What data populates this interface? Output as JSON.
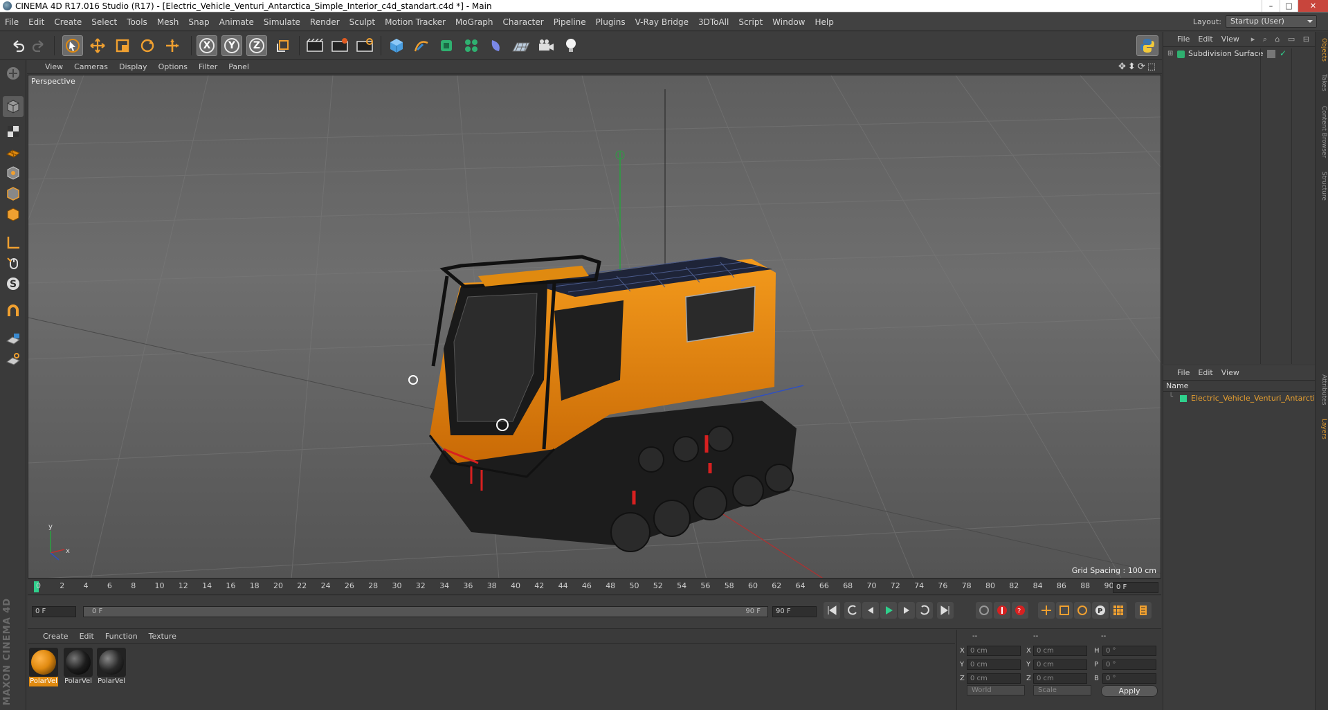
{
  "window": {
    "title": "CINEMA 4D R17.016 Studio (R17) - [Electric_Vehicle_Venturi_Antarctica_Simple_Interior_c4d_standart.c4d *] - Main",
    "controls": [
      "–",
      "□",
      "✕"
    ]
  },
  "menubar": {
    "items": [
      "File",
      "Edit",
      "Create",
      "Select",
      "Tools",
      "Mesh",
      "Snap",
      "Animate",
      "Simulate",
      "Render",
      "Sculpt",
      "Motion Tracker",
      "MoGraph",
      "Character",
      "Pipeline",
      "Plugins",
      "V-Ray Bridge",
      "3DToAll",
      "Script",
      "Window",
      "Help"
    ],
    "layout_label": "Layout:",
    "layout_value": "Startup (User)"
  },
  "toolbar": {
    "icons": [
      "undo-icon",
      "redo-icon",
      "live-selection-icon",
      "move-icon",
      "scale-icon",
      "rotate-icon",
      "last-tool-icon",
      "x-axis-icon",
      "y-axis-icon",
      "z-axis-icon",
      "coordinate-system-icon",
      "render-view-icon",
      "render-picture-viewer-icon",
      "edit-render-settings-icon",
      "cube-icon",
      "pen-spline-icon",
      "subdivision-generator-icon",
      "cloner-icon",
      "deformer-icon",
      "floor-icon",
      "camera-icon",
      "light-icon",
      "python-icon"
    ],
    "axis_labels": [
      "X",
      "Y",
      "Z"
    ]
  },
  "viewport": {
    "menu": [
      "View",
      "Cameras",
      "Display",
      "Options",
      "Filter",
      "Panel"
    ],
    "label": "Perspective",
    "grid_spacing": "Grid Spacing : 100 cm"
  },
  "timeline": {
    "ticks": [
      "0",
      "2",
      "4",
      "6",
      "8",
      "10",
      "12",
      "14",
      "16",
      "18",
      "20",
      "22",
      "24",
      "26",
      "28",
      "30",
      "32",
      "34",
      "36",
      "38",
      "40",
      "42",
      "44",
      "46",
      "48",
      "50",
      "52",
      "54",
      "56",
      "58",
      "60",
      "62",
      "64",
      "66",
      "68",
      "70",
      "72",
      "74",
      "76",
      "78",
      "80",
      "82",
      "84",
      "86",
      "88",
      "90"
    ],
    "current_frame": "0 F"
  },
  "transport": {
    "start_field": "0 F",
    "range_start": "0 F",
    "range_end": "90 F",
    "end_field": "90 F"
  },
  "materials": {
    "menu": [
      "Create",
      "Edit",
      "Function",
      "Texture"
    ],
    "items": [
      {
        "label": "PolarVel",
        "color": "#e08a10",
        "selected": true
      },
      {
        "label": "PolarVel",
        "color": "#1c1c1c",
        "selected": false
      },
      {
        "label": "PolarVel",
        "color": "#2a2a2a",
        "selected": false
      }
    ]
  },
  "coordinates": {
    "headers": [
      "--",
      "--",
      "--"
    ],
    "rows": [
      {
        "a": "X",
        "av": "0 cm",
        "b": "X",
        "bv": "0 cm",
        "c": "H",
        "cv": "0 °"
      },
      {
        "a": "Y",
        "av": "0 cm",
        "b": "Y",
        "bv": "0 cm",
        "c": "P",
        "cv": "0 °"
      },
      {
        "a": "Z",
        "av": "0 cm",
        "b": "Z",
        "bv": "0 cm",
        "c": "B",
        "cv": "0 °"
      }
    ],
    "space": "World",
    "mode": "Scale",
    "apply": "Apply"
  },
  "objects": {
    "menu": [
      "File",
      "Edit",
      "View"
    ],
    "items": [
      {
        "name": "Subdivision Surface"
      }
    ]
  },
  "layers": {
    "menu": [
      "File",
      "Edit",
      "View"
    ],
    "column": "Name",
    "items": [
      {
        "name": "Electric_Vehicle_Venturi_Antarctica",
        "color": "#2fd08c"
      }
    ]
  },
  "right_tabs": [
    "Objects",
    "Takes",
    "Content Browser",
    "Structure",
    "Attributes",
    "Layers"
  ],
  "brand": "MAXON CINEMA 4D",
  "colors": {
    "accent": "#e08a10",
    "bg": "#3a3a3a",
    "layer": "#2fd08c"
  }
}
